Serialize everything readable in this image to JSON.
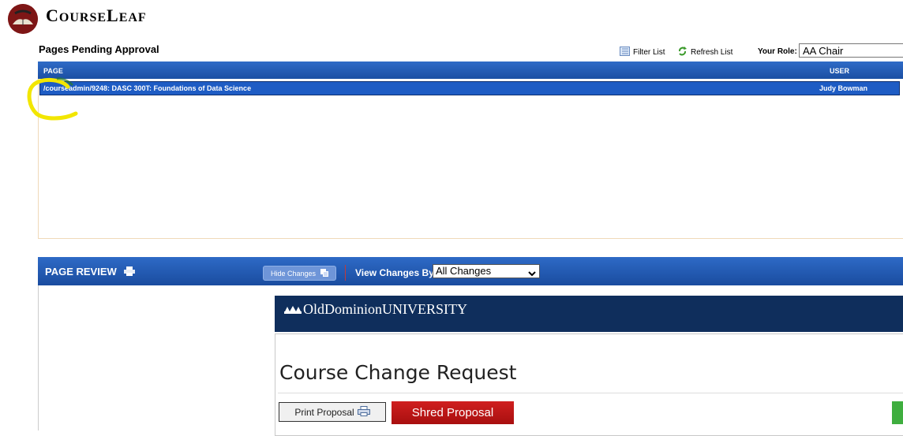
{
  "app": {
    "name_first": "C",
    "name_rest1": "OURSE",
    "name_mid": "L",
    "name_rest2": "EAF"
  },
  "pending": {
    "title": "Pages Pending Approval",
    "filter_label": "Filter List",
    "refresh_label": "Refresh List",
    "role_label": "Your Role:",
    "role_value": "AA Chair",
    "columns": {
      "page": "PAGE",
      "user": "USER"
    },
    "rows": [
      {
        "page": "/courseadmin/9248: DASC 300T: Foundations of Data Science",
        "user": "Judy Bowman",
        "selected": true
      }
    ]
  },
  "review": {
    "title": "PAGE REVIEW",
    "hide_changes_label": "Hide Changes",
    "view_changes_label": "View Changes By:",
    "view_changes_value": "All Changes"
  },
  "proposal": {
    "university": "OldDominionUNIVERSITY",
    "title": "Course Change Request",
    "print_label": "Print Proposal",
    "shred_label": "Shred Proposal"
  },
  "colors": {
    "header_blue": "#1b4fa3",
    "row_blue": "#1e5cc4",
    "odu_navy": "#0f2e5c",
    "shred_red": "#c01818",
    "annotation_yellow": "#f2e600"
  }
}
